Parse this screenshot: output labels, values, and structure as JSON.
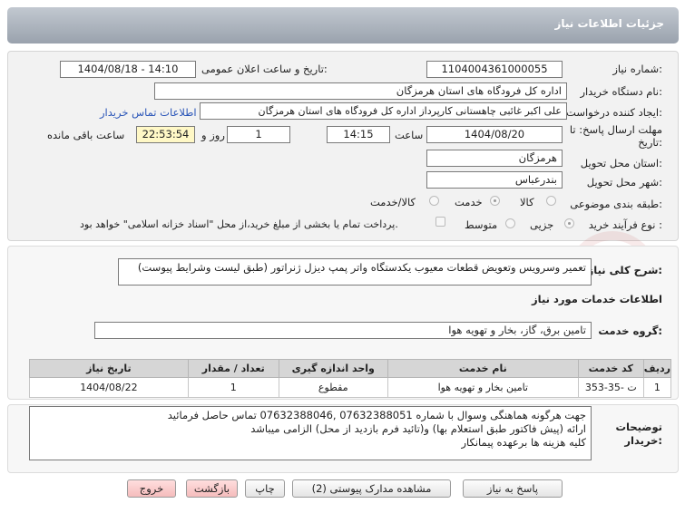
{
  "header": {
    "title": "جزئیات اطلاعات نیاز"
  },
  "form": {
    "need_number_label": "شماره نیاز:",
    "need_number": "1104004361000055",
    "announce_label": "تاریخ و ساعت اعلان عمومی:",
    "announce_value": "1404/08/18 - 14:10",
    "buyer_org_label": "نام دستگاه خریدار:",
    "buyer_org": "اداره کل فرودگاه های استان هرمزگان",
    "creator_label": "ایجاد کننده درخواست:",
    "creator": "علی اکبر غائبی چاهستانی کارپرداز اداره کل فرودگاه های استان هرمزگان",
    "contact_link": "اطلاعات تماس خریدار",
    "deadline_label": "مهلت ارسال پاسخ: تا",
    "deadline_label2": "تاریخ:",
    "deadline_date": "1404/08/20",
    "time_label": "ساعت",
    "deadline_time": "14:15",
    "days_value": "1",
    "days_label": "روز و",
    "remaining_time": "22:53:54",
    "remaining_label": "ساعت باقی مانده",
    "province_label": "استان محل تحویل:",
    "province": "هرمزگان",
    "city_label": "شهر محل تحویل:",
    "city": "بندرعباس",
    "category_label": "طبقه بندی موضوعی:",
    "category_options": [
      "کالا",
      "خدمت",
      "کالا/خدمت"
    ],
    "category_selected": "خدمت",
    "process_label": "نوع فرآیند خرید :",
    "process_options": [
      "جزیی",
      "متوسط"
    ],
    "process_selected": "جزیی",
    "payment_note": "پرداخت تمام یا بخشی از مبلغ خرید،از محل \"اسناد خزانه اسلامی\" خواهد بود."
  },
  "details": {
    "summary_label": "شرح کلی نیاز:",
    "summary": "تعمیر وسرویس وتعویض قطعات معیوب یکدستگاه واتر پمپ دیزل ژنراتور (طبق لیست وشرایط پیوست)",
    "services_header": "اطلاعات خدمات مورد نیاز",
    "service_group_label": "گروه خدمت:",
    "service_group": "تامین برق، گاز، بخار و تهویه هوا",
    "table": {
      "headers": [
        "ردیف",
        "کد خدمت",
        "نام خدمت",
        "واحد اندازه گیری",
        "تعداد / مقدار",
        "تاریخ نیاز"
      ],
      "rows": [
        [
          "1",
          "ت -35-353",
          "تامین بخار و تهویه هوا",
          "مقطوع",
          "1",
          "1404/08/22"
        ]
      ]
    }
  },
  "notes": {
    "label_line1": "توضیحات",
    "label_line2": "خریدار:",
    "line1": "جهت هرگونه هماهنگی وسوال با شماره 07632388051 ,07632388046 تماس حاصل فرمائید",
    "line2": "ارائه (پیش فاکتور طبق استعلام بها)  و(تائید فرم بازدید از محل)  الزامی میباشد",
    "line3": "کلیه هزینه ها برعهده پیمانکار"
  },
  "buttons": {
    "reply": "پاسخ به نیاز",
    "attachments": "مشاهده مدارک پیوستی (2)",
    "print": "چاپ",
    "back": "بازگشت",
    "exit": "خروج"
  },
  "watermark": "AriaTender.net"
}
